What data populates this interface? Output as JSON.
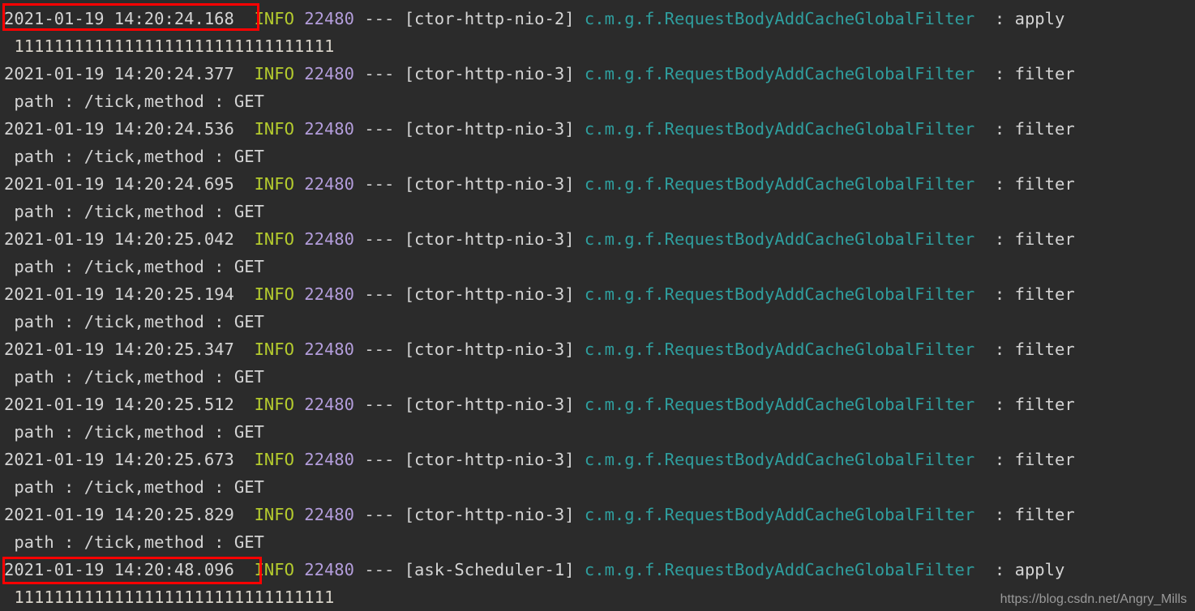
{
  "window": {
    "title": "Console Log Output",
    "background_color": "#2b2b2b"
  },
  "colors": {
    "background": "#2b2b2b",
    "timestamp": "#d4d4d4",
    "level_info": "#b5cc2e",
    "pid": "#b39ddb",
    "thread": "#d4d4d4",
    "logger": "#2f9e9e",
    "message": "#d4d4d4",
    "highlight_box": "#ff0000",
    "watermark": "#9a9a9a"
  },
  "clipped_top_row": " ",
  "log": {
    "common": {
      "level": "INFO",
      "pid": "22480",
      "dashes": "---",
      "logger": "c.m.g.f.RequestBodyAddCacheGlobalFilter",
      "separator": ":",
      "path_line": " path : /tick,method : GET",
      "ones_line": " 11111111111111111111111111111111",
      "thread_nio2": "[ctor-http-nio-2]",
      "thread_nio3": "[ctor-http-nio-3]",
      "thread_scheduler": "[ask-Scheduler-1]",
      "msg_apply": "apply",
      "msg_filter": "filter"
    },
    "entries": [
      {
        "timestamp": "2021-01-19 14:20:24.168",
        "level": "INFO",
        "pid": "22480",
        "thread": "[ctor-http-nio-2]",
        "logger": "c.m.g.f.RequestBodyAddCacheGlobalFilter",
        "message": "apply",
        "continuation": " 11111111111111111111111111111111",
        "continuation_kind": "ones",
        "highlighted": true
      },
      {
        "timestamp": "2021-01-19 14:20:24.377",
        "level": "INFO",
        "pid": "22480",
        "thread": "[ctor-http-nio-3]",
        "logger": "c.m.g.f.RequestBodyAddCacheGlobalFilter",
        "message": "filter",
        "continuation": " path : /tick,method : GET",
        "continuation_kind": "path",
        "highlighted": false
      },
      {
        "timestamp": "2021-01-19 14:20:24.536",
        "level": "INFO",
        "pid": "22480",
        "thread": "[ctor-http-nio-3]",
        "logger": "c.m.g.f.RequestBodyAddCacheGlobalFilter",
        "message": "filter",
        "continuation": " path : /tick,method : GET",
        "continuation_kind": "path",
        "highlighted": false
      },
      {
        "timestamp": "2021-01-19 14:20:24.695",
        "level": "INFO",
        "pid": "22480",
        "thread": "[ctor-http-nio-3]",
        "logger": "c.m.g.f.RequestBodyAddCacheGlobalFilter",
        "message": "filter",
        "continuation": " path : /tick,method : GET",
        "continuation_kind": "path",
        "highlighted": false
      },
      {
        "timestamp": "2021-01-19 14:20:25.042",
        "level": "INFO",
        "pid": "22480",
        "thread": "[ctor-http-nio-3]",
        "logger": "c.m.g.f.RequestBodyAddCacheGlobalFilter",
        "message": "filter",
        "continuation": " path : /tick,method : GET",
        "continuation_kind": "path",
        "highlighted": false
      },
      {
        "timestamp": "2021-01-19 14:20:25.194",
        "level": "INFO",
        "pid": "22480",
        "thread": "[ctor-http-nio-3]",
        "logger": "c.m.g.f.RequestBodyAddCacheGlobalFilter",
        "message": "filter",
        "continuation": " path : /tick,method : GET",
        "continuation_kind": "path",
        "highlighted": false
      },
      {
        "timestamp": "2021-01-19 14:20:25.347",
        "level": "INFO",
        "pid": "22480",
        "thread": "[ctor-http-nio-3]",
        "logger": "c.m.g.f.RequestBodyAddCacheGlobalFilter",
        "message": "filter",
        "continuation": " path : /tick,method : GET",
        "continuation_kind": "path",
        "highlighted": false
      },
      {
        "timestamp": "2021-01-19 14:20:25.512",
        "level": "INFO",
        "pid": "22480",
        "thread": "[ctor-http-nio-3]",
        "logger": "c.m.g.f.RequestBodyAddCacheGlobalFilter",
        "message": "filter",
        "continuation": " path : /tick,method : GET",
        "continuation_kind": "path",
        "highlighted": false
      },
      {
        "timestamp": "2021-01-19 14:20:25.673",
        "level": "INFO",
        "pid": "22480",
        "thread": "[ctor-http-nio-3]",
        "logger": "c.m.g.f.RequestBodyAddCacheGlobalFilter",
        "message": "filter",
        "continuation": " path : /tick,method : GET",
        "continuation_kind": "path",
        "highlighted": false
      },
      {
        "timestamp": "2021-01-19 14:20:25.829",
        "level": "INFO",
        "pid": "22480",
        "thread": "[ctor-http-nio-3]",
        "logger": "c.m.g.f.RequestBodyAddCacheGlobalFilter",
        "message": "filter",
        "continuation": " path : /tick,method : GET",
        "continuation_kind": "path",
        "highlighted": false
      },
      {
        "timestamp": "2021-01-19 14:20:48.096",
        "level": "INFO",
        "pid": "22480",
        "thread": "[ask-Scheduler-1]",
        "logger": "c.m.g.f.RequestBodyAddCacheGlobalFilter",
        "message": "apply",
        "continuation": " 11111111111111111111111111111111",
        "continuation_kind": "ones",
        "highlighted": true
      }
    ]
  },
  "annotations": {
    "highlight_boxes": [
      {
        "target": "2021-01-19 14:20:24.168",
        "color": "#ff0000"
      },
      {
        "target": "2021-01-19 14:20:48.096",
        "color": "#ff0000"
      }
    ]
  },
  "watermark": {
    "text": "https://blog.csdn.net/Angry_Mills"
  }
}
